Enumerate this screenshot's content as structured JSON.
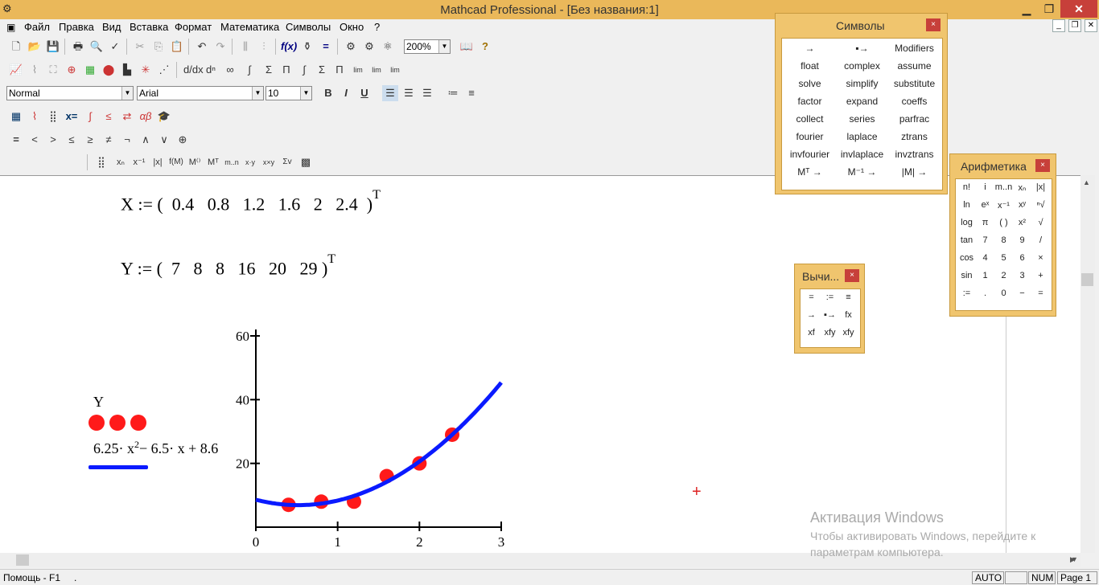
{
  "window": {
    "title": "Mathcad Professional - [Без названия:1]",
    "min": "▁",
    "max": "❐",
    "close": "✕"
  },
  "menu": [
    "Файл",
    "Правка",
    "Вид",
    "Вставка",
    "Формат",
    "Математика",
    "Символы",
    "Окно",
    "?"
  ],
  "toolbar": {
    "zoom": "200%",
    "style": "Normal",
    "font": "Arial",
    "size": "10",
    "bold": "B",
    "italic": "I",
    "underline": "U"
  },
  "eval_row": [
    "=",
    "<",
    ">",
    "≤",
    "≥",
    "≠",
    "¬",
    "∧",
    "∨",
    "⊕"
  ],
  "doc": {
    "x_def": {
      "name": "X",
      "assign": ":=",
      "values": [
        "0.4",
        "0.8",
        "1.2",
        "1.6",
        "2",
        "2.4"
      ],
      "transpose": "T"
    },
    "y_def": {
      "name": "Y",
      "assign": ":=",
      "values": [
        "7",
        "8",
        "8",
        "16",
        "20",
        "29"
      ],
      "transpose": "T"
    },
    "legend": {
      "series1": "Y",
      "series2_main": "6.25· x",
      "series2_exp": "2",
      "series2_rest": "− 6.5· x + 8.6"
    }
  },
  "chart_data": {
    "type": "scatter",
    "xlim": [
      0,
      3
    ],
    "ylim": [
      0,
      60
    ],
    "xticks": [
      "0",
      "1",
      "2",
      "3"
    ],
    "yticks": [
      "20",
      "40",
      "60"
    ],
    "series": [
      {
        "name": "Y",
        "type": "scatter",
        "color": "#ff1a1a",
        "x": [
          0.4,
          0.8,
          1.2,
          1.6,
          2,
          2.4
        ],
        "y": [
          7,
          8,
          8,
          16,
          20,
          29
        ]
      },
      {
        "name": "6.25·x²−6.5·x+8.6",
        "type": "line",
        "color": "#0a1aff",
        "fn": {
          "a": 6.25,
          "b": -6.5,
          "c": 8.6
        }
      }
    ]
  },
  "palettes": {
    "symbols": {
      "title": "Символы",
      "items": [
        "→",
        "▪→",
        "Modifiers",
        "float",
        "complex",
        "assume",
        "solve",
        "simplify",
        "substitute",
        "factor",
        "expand",
        "coeffs",
        "collect",
        "series",
        "parfrac",
        "fourier",
        "laplace",
        "ztrans",
        "invfourier",
        "invlaplace",
        "invztrans",
        "Mᵀ →",
        "M⁻¹ →",
        "|M| →"
      ]
    },
    "arith": {
      "title": "Арифметика",
      "items": [
        "n!",
        "i",
        "m..n",
        "xₙ",
        "|x|",
        "ln",
        "eˣ",
        "x⁻¹",
        "xʸ",
        "ⁿ√",
        "log",
        "π",
        "( )",
        "x²",
        "√",
        "tan",
        "7",
        "8",
        "9",
        "/",
        "cos",
        "4",
        "5",
        "6",
        "×",
        "sin",
        "1",
        "2",
        "3",
        "+",
        ":=",
        ".",
        "0",
        "−",
        "="
      ]
    },
    "eval": {
      "title": "Вычи...",
      "items": [
        "=",
        ":=",
        "≡",
        "→",
        "▪→",
        "fx",
        "xf",
        "xfy",
        "xfy"
      ]
    }
  },
  "watermark": {
    "line1": "Активация Windows",
    "line2": "Чтобы активировать Windows, перейдите к параметрам компьютера."
  },
  "status": {
    "help": "Помощь - F1",
    "dot": ".",
    "auto": "AUTO",
    "num": "NUM",
    "page": "Page 1"
  }
}
